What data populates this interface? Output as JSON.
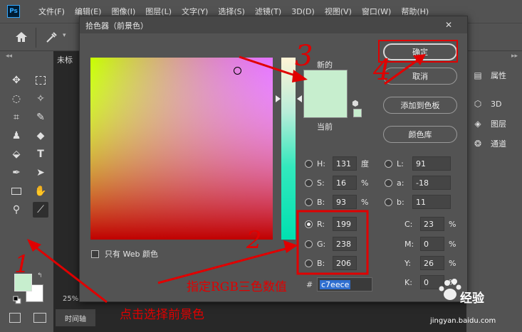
{
  "menubar": {
    "logo": "Ps",
    "items": [
      "文件(F)",
      "编辑(E)",
      "图像(I)",
      "图层(L)",
      "文字(Y)",
      "选择(S)",
      "滤镜(T)",
      "3D(D)",
      "视图(V)",
      "窗口(W)",
      "帮助(H)"
    ]
  },
  "document": {
    "tab_label": "未标",
    "zoom": "25%",
    "timeline_tab": "时间轴"
  },
  "right_panel": {
    "items": [
      {
        "label": "属性",
        "icon": "properties-icon"
      },
      {
        "label": "3D",
        "icon": "cube-icon"
      },
      {
        "label": "图层",
        "icon": "layers-icon"
      },
      {
        "label": "通道",
        "icon": "channels-icon"
      }
    ]
  },
  "dialog": {
    "title": "拾色器（前景色）",
    "close": "✕",
    "new_label": "新的",
    "current_label": "当前",
    "buttons": {
      "ok": "确定",
      "cancel": "取消",
      "add_swatch": "添加到色板",
      "color_library": "颜色库"
    },
    "hsb": [
      {
        "label": "H:",
        "value": "131",
        "unit": "度",
        "selected": false
      },
      {
        "label": "S:",
        "value": "16",
        "unit": "%",
        "selected": false
      },
      {
        "label": "B:",
        "value": "93",
        "unit": "%",
        "selected": false
      }
    ],
    "rgb": [
      {
        "label": "R:",
        "value": "199",
        "selected": true
      },
      {
        "label": "G:",
        "value": "238",
        "selected": false
      },
      {
        "label": "B:",
        "value": "206",
        "selected": false
      }
    ],
    "lab": [
      {
        "label": "L:",
        "value": "91"
      },
      {
        "label": "a:",
        "value": "-18"
      },
      {
        "label": "b:",
        "value": "11"
      }
    ],
    "cmyk": [
      {
        "label": "C:",
        "value": "23",
        "unit": "%"
      },
      {
        "label": "M:",
        "value": "0",
        "unit": "%"
      },
      {
        "label": "Y:",
        "value": "26",
        "unit": "%"
      },
      {
        "label": "K:",
        "value": "0",
        "unit": "%"
      }
    ],
    "hex_label": "#",
    "hex_value": "c7eece",
    "web_only_label": "只有 Web 颜色",
    "current_color": "#c7eece"
  },
  "annotations": {
    "step1_text": "点击选择前景色",
    "step2_text": "指定RGB三色数值",
    "num1": "1",
    "num2": "2",
    "num3": "3",
    "num4": "4",
    "color": "#e00000"
  },
  "watermark": {
    "brand": "经验",
    "url": "jingyan.baidu.com"
  }
}
